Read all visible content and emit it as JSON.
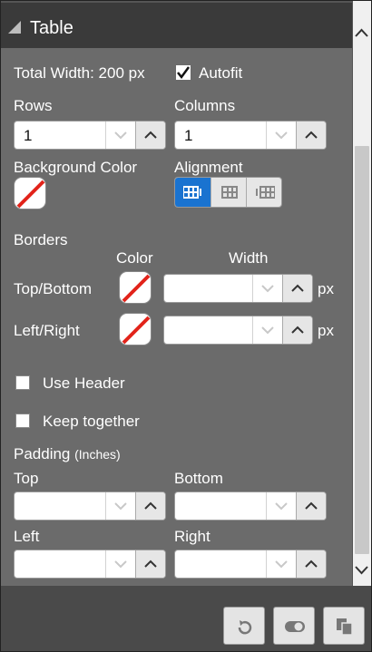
{
  "panel": {
    "title": "Table"
  },
  "total_width": {
    "label": "Total Width: 200 px"
  },
  "autofit": {
    "label": "Autofit",
    "checked": true
  },
  "rows": {
    "label": "Rows",
    "value": "1"
  },
  "columns": {
    "label": "Columns",
    "value": "1"
  },
  "background_color": {
    "label": "Background Color",
    "value": "none"
  },
  "alignment": {
    "label": "Alignment",
    "options": [
      "left",
      "center",
      "right"
    ],
    "selected": "left",
    "accent": "#1a73d0"
  },
  "borders": {
    "label": "Borders",
    "color_header": "Color",
    "width_header": "Width",
    "top_bottom": {
      "label": "Top/Bottom",
      "color": "none",
      "width": "",
      "unit": "px"
    },
    "left_right": {
      "label": "Left/Right",
      "color": "none",
      "width": "",
      "unit": "px"
    }
  },
  "use_header": {
    "label": "Use Header",
    "checked": false
  },
  "keep_together": {
    "label": "Keep together",
    "checked": false
  },
  "padding": {
    "label": "Padding",
    "unit_note": "(Inches)",
    "top": {
      "label": "Top",
      "value": ""
    },
    "bottom": {
      "label": "Bottom",
      "value": ""
    },
    "left": {
      "label": "Left",
      "value": ""
    },
    "right": {
      "label": "Right",
      "value": ""
    }
  },
  "footer": {
    "buttons": [
      "refresh-icon",
      "toggle-icon",
      "copy-icon"
    ]
  }
}
